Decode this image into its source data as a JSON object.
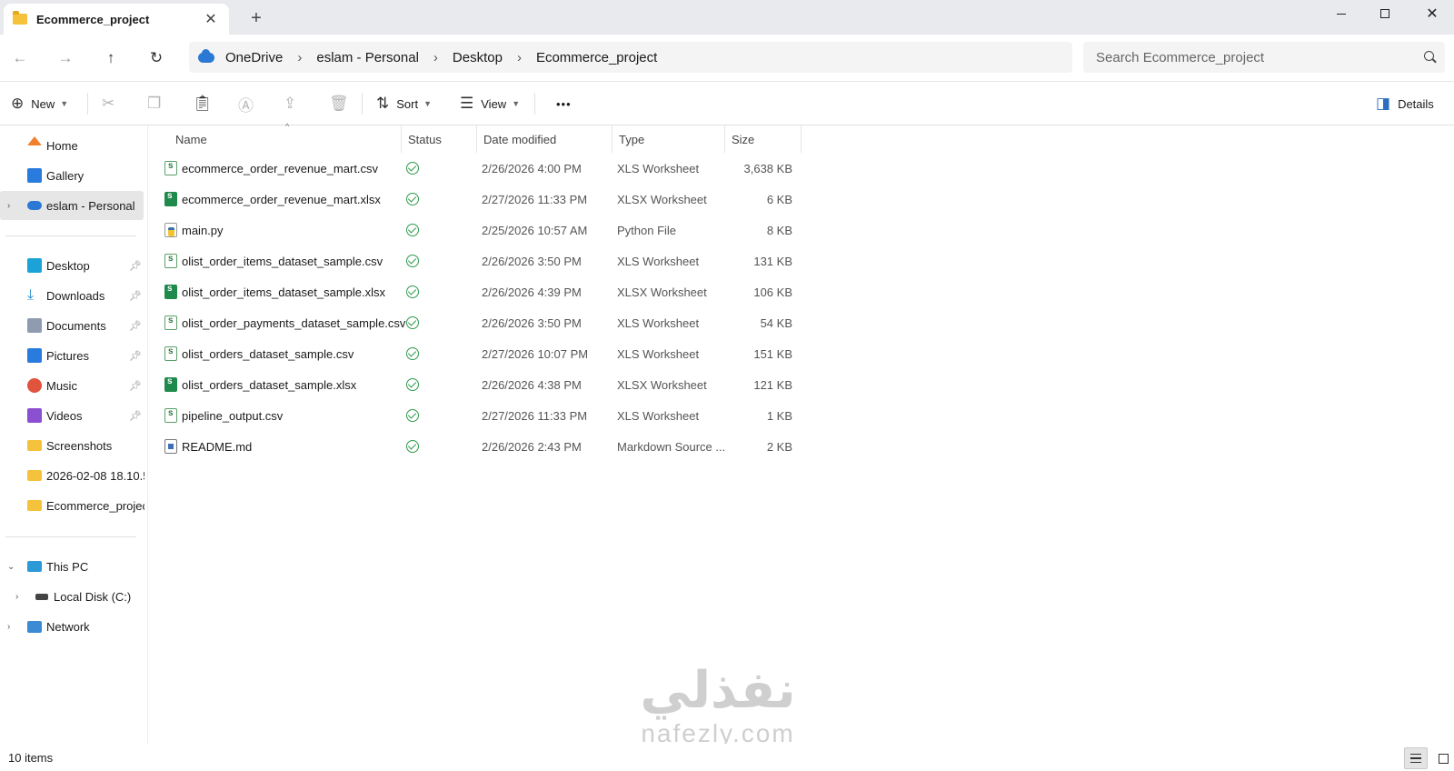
{
  "tab": {
    "title": "Ecommerce_project"
  },
  "address": {
    "breadcrumbs": [
      "OneDrive",
      "eslam - Personal",
      "Desktop",
      "Ecommerce_project"
    ]
  },
  "search": {
    "placeholder": "Search Ecommerce_project"
  },
  "commands": {
    "new": "New",
    "sort": "Sort",
    "view": "View",
    "more": "•••",
    "details": "Details"
  },
  "sidebar": {
    "home": "Home",
    "gallery": "Gallery",
    "personal": "eslam - Personal",
    "quick_access": [
      {
        "label": "Desktop",
        "icon": "desktop-icon",
        "pinned": true
      },
      {
        "label": "Downloads",
        "icon": "downloads-icon",
        "pinned": true
      },
      {
        "label": "Documents",
        "icon": "documents-icon",
        "pinned": true
      },
      {
        "label": "Pictures",
        "icon": "pictures-icon",
        "pinned": true
      },
      {
        "label": "Music",
        "icon": "music-icon",
        "pinned": true
      },
      {
        "label": "Videos",
        "icon": "videos-icon",
        "pinned": true
      },
      {
        "label": "Screenshots",
        "icon": "folder-icon",
        "pinned": false
      },
      {
        "label": "2026-02-08 18.10.5",
        "icon": "folder-icon",
        "pinned": false
      },
      {
        "label": "Ecommerce_projec",
        "icon": "folder-icon",
        "pinned": false
      }
    ],
    "this_pc": "This PC",
    "local_disk": "Local Disk (C:)",
    "network": "Network"
  },
  "columns": {
    "name": "Name",
    "status": "Status",
    "date_modified": "Date modified",
    "type": "Type",
    "size": "Size"
  },
  "files": [
    {
      "name": "ecommerce_order_revenue_mart.csv",
      "date": "2/26/2026 4:00 PM",
      "type": "XLS Worksheet",
      "size": "3,638 KB",
      "kind": "csv"
    },
    {
      "name": "ecommerce_order_revenue_mart.xlsx",
      "date": "2/27/2026 11:33 PM",
      "type": "XLSX Worksheet",
      "size": "6 KB",
      "kind": "xlsx"
    },
    {
      "name": "main.py",
      "date": "2/25/2026 10:57 AM",
      "type": "Python File",
      "size": "8 KB",
      "kind": "py"
    },
    {
      "name": "olist_order_items_dataset_sample.csv",
      "date": "2/26/2026 3:50 PM",
      "type": "XLS Worksheet",
      "size": "131 KB",
      "kind": "csv"
    },
    {
      "name": "olist_order_items_dataset_sample.xlsx",
      "date": "2/26/2026 4:39 PM",
      "type": "XLSX Worksheet",
      "size": "106 KB",
      "kind": "xlsx"
    },
    {
      "name": "olist_order_payments_dataset_sample.csv",
      "date": "2/26/2026 3:50 PM",
      "type": "XLS Worksheet",
      "size": "54 KB",
      "kind": "csv"
    },
    {
      "name": "olist_orders_dataset_sample.csv",
      "date": "2/27/2026 10:07 PM",
      "type": "XLS Worksheet",
      "size": "151 KB",
      "kind": "csv"
    },
    {
      "name": "olist_orders_dataset_sample.xlsx",
      "date": "2/26/2026 4:38 PM",
      "type": "XLSX Worksheet",
      "size": "121 KB",
      "kind": "xlsx"
    },
    {
      "name": "pipeline_output.csv",
      "date": "2/27/2026 11:33 PM",
      "type": "XLS Worksheet",
      "size": "1 KB",
      "kind": "csv"
    },
    {
      "name": "README.md",
      "date": "2/26/2026 2:43 PM",
      "type": "Markdown Source ...",
      "size": "2 KB",
      "kind": "md"
    }
  ],
  "watermark": {
    "logo": "نفذلي",
    "url": "nafezly.com"
  },
  "status": {
    "item_count": "10 items"
  }
}
